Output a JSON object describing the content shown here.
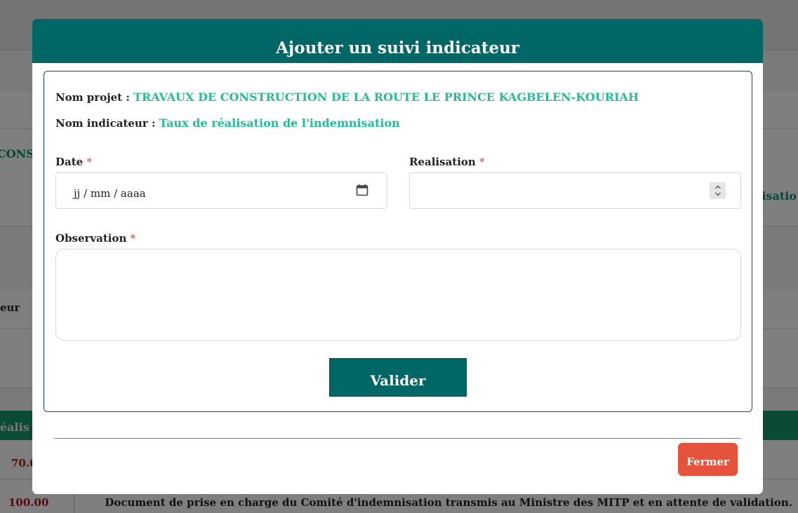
{
  "background": {
    "left_fragment_cons": "CONS",
    "right_fragment_indemnisation": "nisatio",
    "left_fragment_eur": "eur",
    "left_fragment_realisation": "éalis",
    "row1_value": "70.0",
    "row2_value": "100.00",
    "row2_document": "Document de prise en charge du Comité d'indemnisation transmis au Ministre des MITP et en attente de validation."
  },
  "modal": {
    "title": "Ajouter un suivi indicateur",
    "projet_label": "Nom projet : ",
    "projet_value": "TRAVAUX DE CONSTRUCTION DE LA ROUTE LE PRINCE KAGBELEN-KOURIAH",
    "indicateur_label": "Nom indicateur : ",
    "indicateur_value": "Taux de réalisation de l'indemnisation",
    "fields": {
      "date_label": "Date",
      "date_placeholder": "jj / mm / aaaa",
      "realisation_label": "Realisation",
      "observation_label": "Observation",
      "required_mark": "*"
    },
    "submit_label": "Valider",
    "close_label": "Fermer"
  },
  "colors": {
    "header": "#006666",
    "accent_text": "#1fbf95",
    "close_button": "#e5533c",
    "required": "#e23b3b"
  },
  "icons": {
    "date": "calendar-icon",
    "number": "spinner-icon"
  }
}
